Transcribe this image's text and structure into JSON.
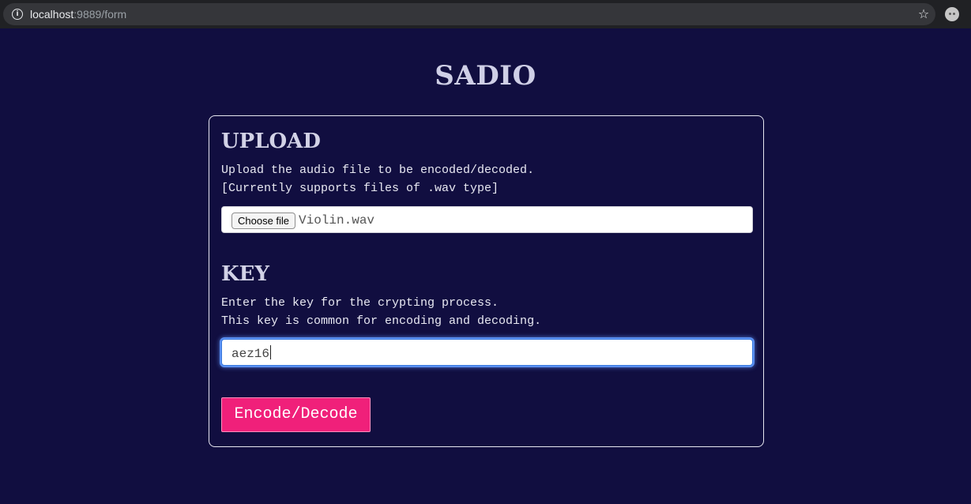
{
  "browser": {
    "url_host": "localhost",
    "url_path": ":9889/form",
    "info_icon": "info-icon",
    "star_icon": "star-icon",
    "extension_icon": "extension-icon"
  },
  "page": {
    "title": "SADIO"
  },
  "upload": {
    "heading": "UPLOAD",
    "description_line1": "Upload the audio file to be encoded/decoded.",
    "description_line2": "[Currently supports files of .wav type]",
    "choose_file_label": "Choose file",
    "file_name": "Violin.wav"
  },
  "key": {
    "heading": "KEY",
    "description_line1": "Enter the key for the crypting process.",
    "description_line2": "This key is common for encoding and decoding.",
    "value": "aez16"
  },
  "submit": {
    "label": "Encode/Decode"
  },
  "colors": {
    "background": "#110e40",
    "accent": "#f0207a",
    "focus_ring": "#5b8ff0"
  }
}
